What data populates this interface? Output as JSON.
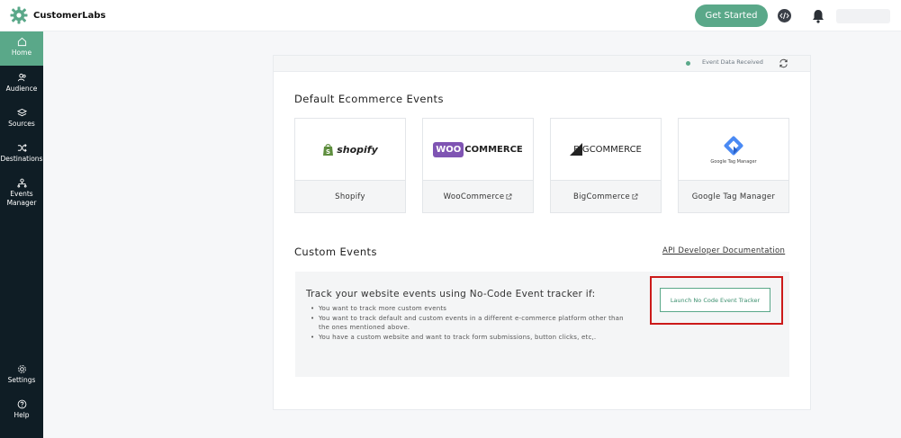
{
  "brand": {
    "name": "CustomerLabs"
  },
  "header": {
    "get_started": "Get Started"
  },
  "sidebar": {
    "items": [
      {
        "label": "Home",
        "icon": "home-icon",
        "active": true
      },
      {
        "label": "Audience",
        "icon": "users-icon"
      },
      {
        "label": "Sources",
        "icon": "layers-icon"
      },
      {
        "label": "Destinations",
        "icon": "shuffle-icon"
      },
      {
        "label": "Events Manager",
        "icon": "events-icon"
      },
      {
        "label": "Settings",
        "icon": "gear-icon"
      },
      {
        "label": "Help",
        "icon": "help-icon"
      }
    ]
  },
  "status": {
    "text": "Event Data Received"
  },
  "default_section": {
    "title": "Default Ecommerce Events",
    "tiles": [
      {
        "label": "Shopify",
        "logo": "shopify",
        "external": false
      },
      {
        "label": "WooCommerce",
        "logo_a": "WOO",
        "logo_b": "COMMERCE",
        "external": true
      },
      {
        "label": "BigCommerce",
        "logo_a": "BIG",
        "logo_b": "COMMERCE",
        "external": true
      },
      {
        "label": "Google Tag Manager",
        "logo": "Google Tag Manager",
        "external": false
      }
    ]
  },
  "custom_section": {
    "title": "Custom Events",
    "api_link": "API Developer Documentation",
    "tracker_title": "Track your website events using No-Code Event tracker if:",
    "bullets": [
      "You want to track more custom events",
      "You want to track default and custom events in a different e-commerce platform other than the ones mentioned above.",
      "You have a custom website and want to track form submissions, button clicks, etc,."
    ],
    "launch_button": "Launch No Code Event Tracker"
  },
  "colors": {
    "accent": "#5aa889",
    "sidebar": "#0f1d25",
    "highlight": "#cc1a1a"
  }
}
